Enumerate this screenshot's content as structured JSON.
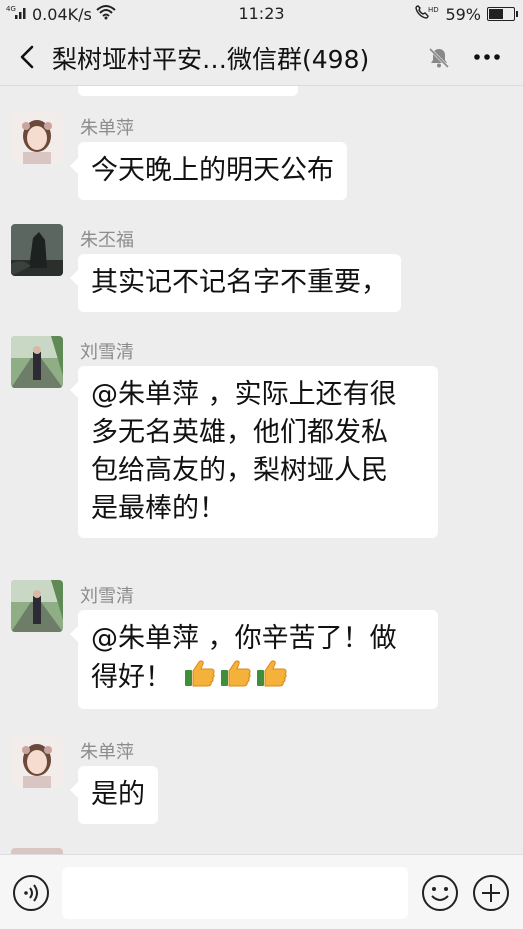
{
  "status_bar": {
    "network_speed": "0.04K/s",
    "time": "11:23",
    "battery": "59%",
    "battery_level": 0.59,
    "signal_label": "4G",
    "hd_label": "HD"
  },
  "header": {
    "title": "梨树垭村平安…微信群(498)",
    "back_icon": "chevron-left-icon",
    "mute_icon": "bell-muted-icon",
    "more_icon": "more-dots-icon"
  },
  "messages": [
    {
      "sender": "朱单萍",
      "lines": [
        "今天晚上的明天公布"
      ],
      "avatar": "avatar-girl"
    },
    {
      "sender": "朱丕福",
      "lines": [
        "其实记不记名字不重要，"
      ],
      "avatar": "avatar-rock"
    },
    {
      "sender": "刘雪清",
      "lines": [
        "@朱单萍 ，实际上还有很",
        "多无名英雄，他们都发私",
        "包给高友的，梨树垭人民",
        "是最棒的！"
      ],
      "avatar": "avatar-road"
    },
    {
      "sender": "刘雪清",
      "lines": [
        "@朱单萍 ，你辛苦了！做",
        "得好！"
      ],
      "avatar": "avatar-road",
      "emoji": "thumbs-up-icon",
      "emoji_count": 3
    },
    {
      "sender": "朱单萍",
      "lines": [
        "是的"
      ],
      "avatar": "avatar-girl"
    }
  ],
  "input_bar": {
    "placeholder": "",
    "voice_icon": "voice-icon",
    "emoji_icon": "emoji-icon",
    "plus_icon": "plus-icon"
  }
}
